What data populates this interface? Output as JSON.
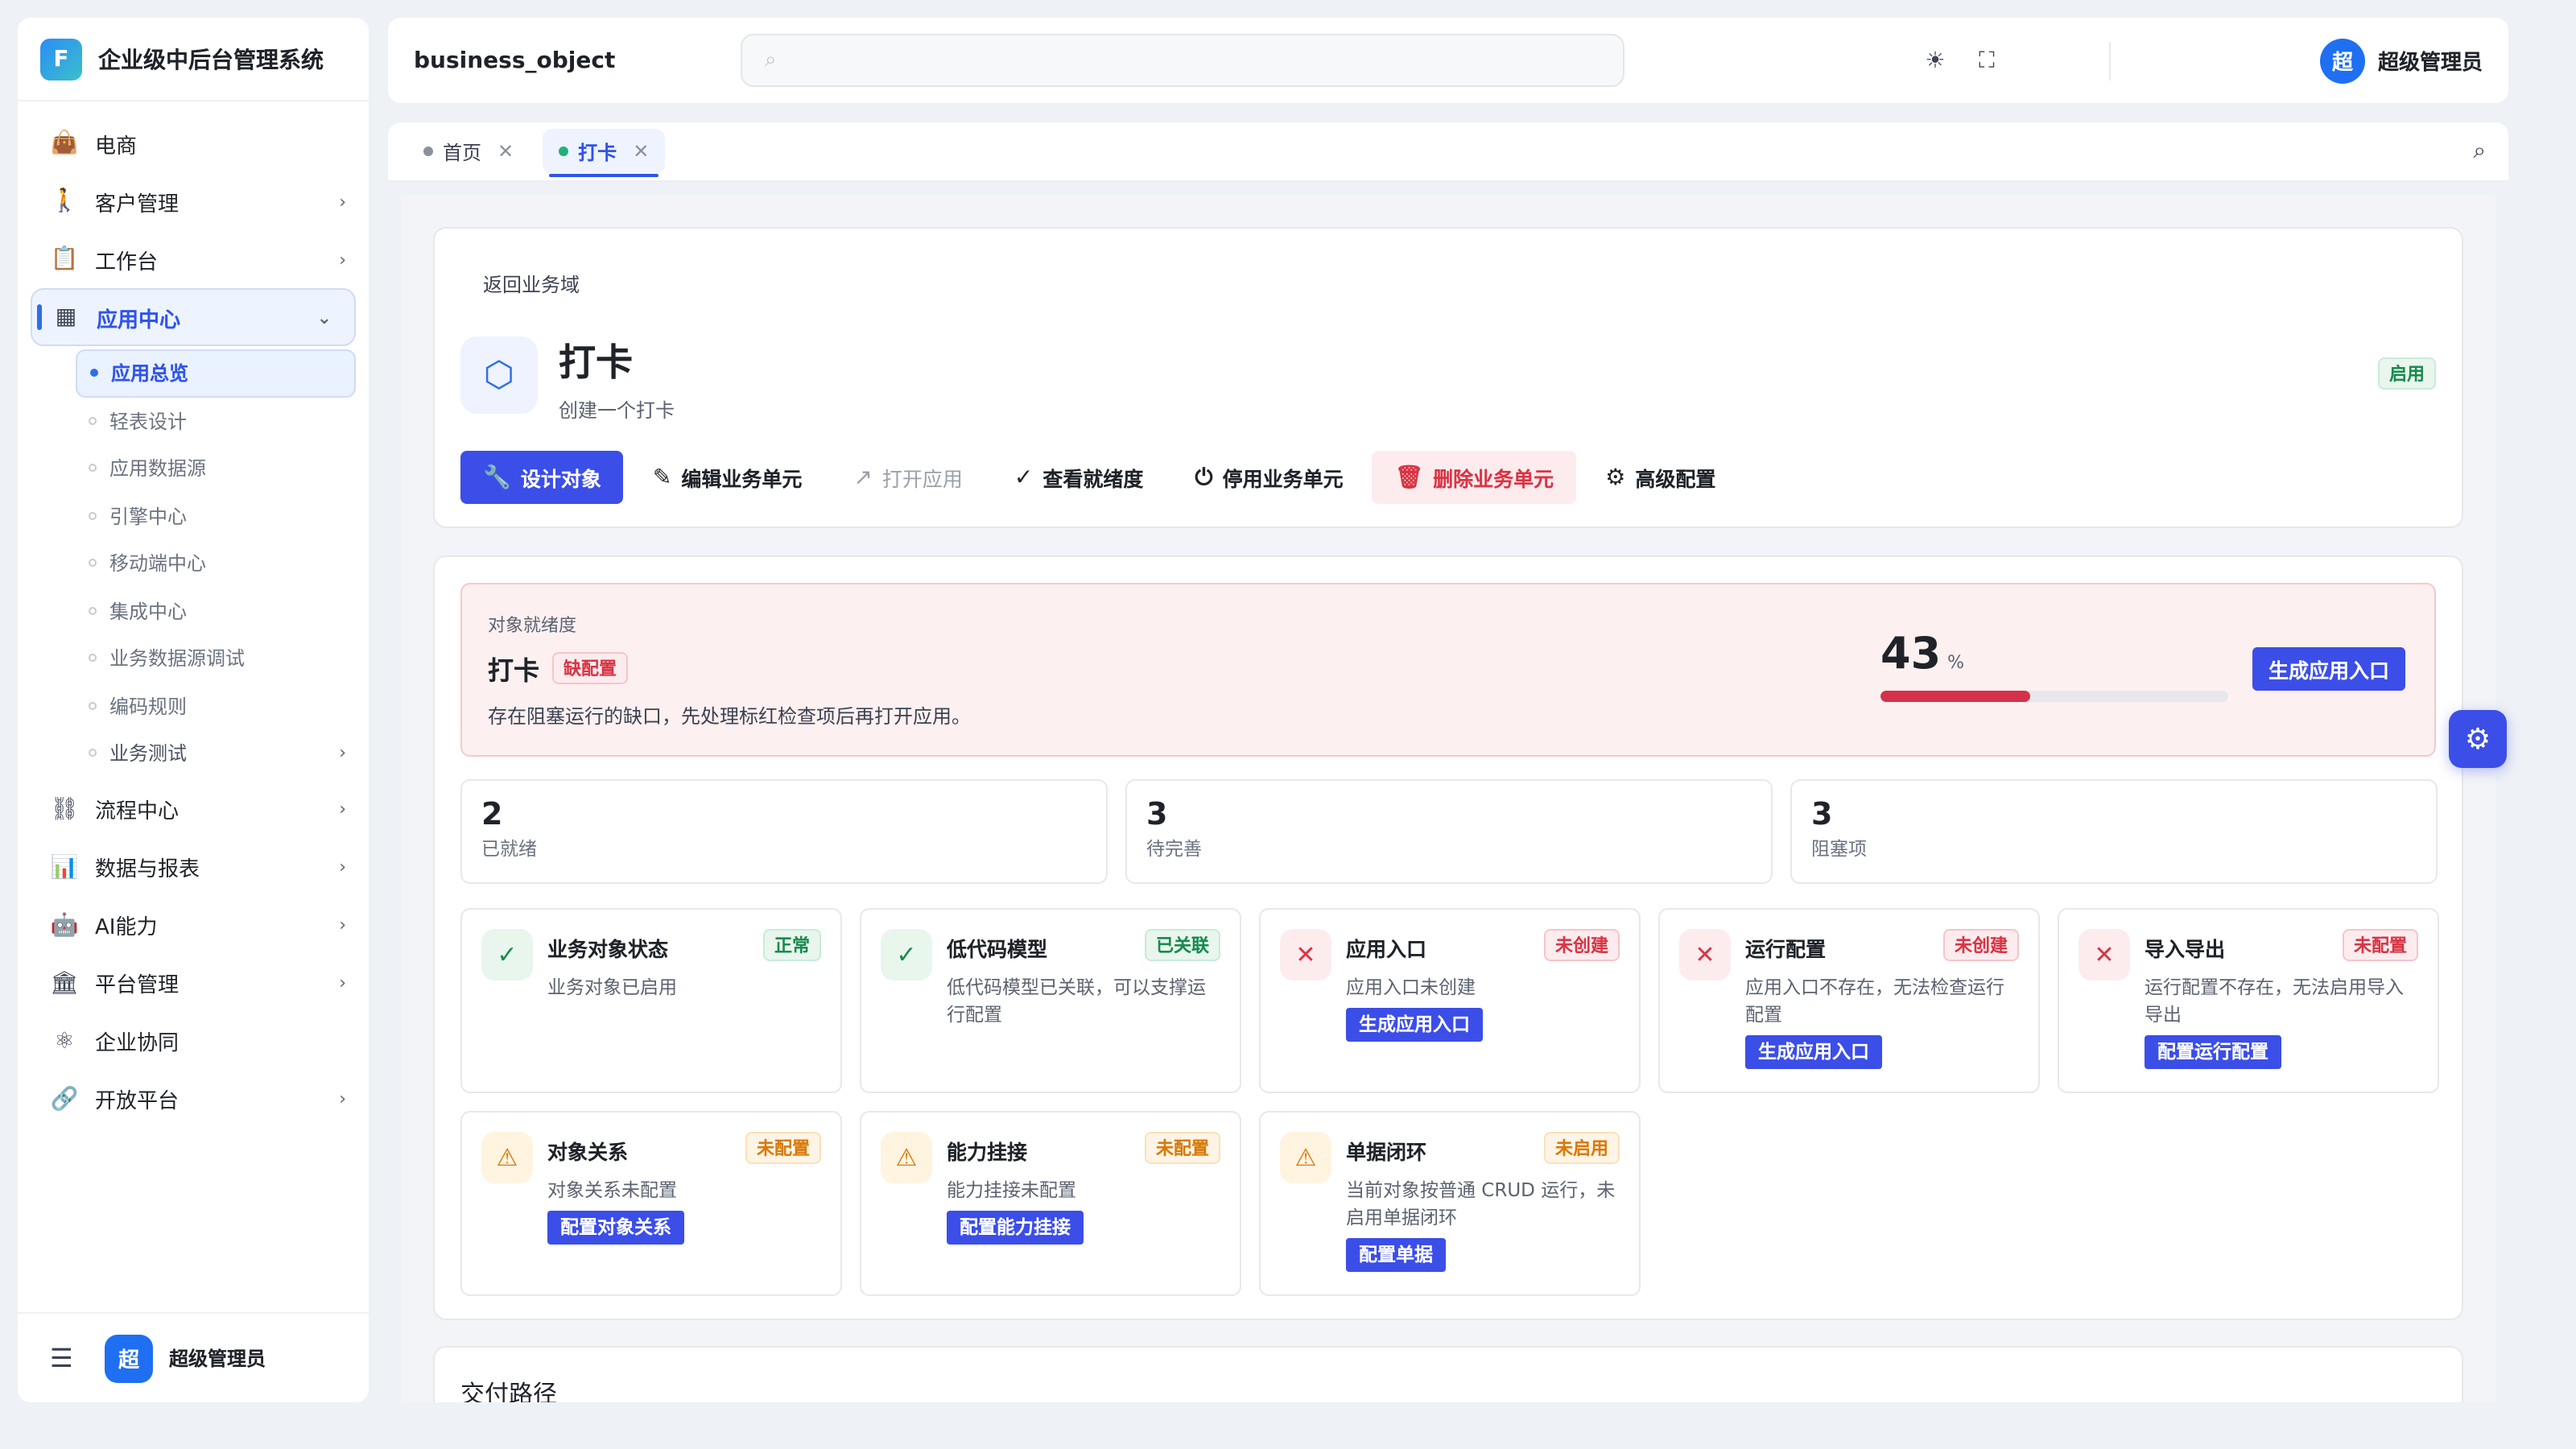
{
  "brand": {
    "title": "企业级中后台管理系统",
    "logo_letter": "F"
  },
  "sidebar": {
    "items": [
      {
        "label": "电商",
        "icon": "bag-icon",
        "glyph": "👜",
        "has_arrow": false
      },
      {
        "label": "客户管理",
        "icon": "person-icon",
        "glyph": "🚶",
        "has_arrow": true
      },
      {
        "label": "工作台",
        "icon": "clipboard-icon",
        "glyph": "📋",
        "has_arrow": true
      },
      {
        "label": "应用中心",
        "icon": "app-center-icon",
        "glyph": "▦",
        "has_arrow": true,
        "active": true
      }
    ],
    "subitems": [
      {
        "label": "应用总览",
        "active": true
      },
      {
        "label": "轻表设计"
      },
      {
        "label": "应用数据源"
      },
      {
        "label": "引擎中心"
      },
      {
        "label": "移动端中心"
      },
      {
        "label": "集成中心"
      },
      {
        "label": "业务数据源调试"
      },
      {
        "label": "编码规则"
      },
      {
        "label": "业务测试",
        "has_children": true
      }
    ],
    "items_after": [
      {
        "label": "流程中心",
        "icon": "flow-icon",
        "glyph": "⛓",
        "has_arrow": true
      },
      {
        "label": "数据与报表",
        "icon": "report-icon",
        "glyph": "📊",
        "has_arrow": true
      },
      {
        "label": "AI能力",
        "icon": "ai-icon",
        "glyph": "🤖",
        "has_arrow": true
      },
      {
        "label": "平台管理",
        "icon": "platform-icon",
        "glyph": "🏛",
        "has_arrow": true
      },
      {
        "label": "企业协同",
        "icon": "collab-icon",
        "glyph": "⚛",
        "has_arrow": false
      },
      {
        "label": "开放平台",
        "icon": "open-platform-icon",
        "glyph": "🔗",
        "has_arrow": true
      }
    ],
    "footer": {
      "avatar_char": "超",
      "username": "超级管理员"
    }
  },
  "header": {
    "app_name": "business_object",
    "search_placeholder": "",
    "avatar_char": "超",
    "username": "超级管理员"
  },
  "tabs": [
    {
      "label": "首页",
      "active": false
    },
    {
      "label": "打卡",
      "active": true
    }
  ],
  "object": {
    "back_label": "返回业务域",
    "title": "打卡",
    "subtitle": "创建一个打卡",
    "status": "启用",
    "actions": [
      {
        "label": "设计对象",
        "icon": "wrench-icon",
        "glyph": "🔧",
        "kind": "primary"
      },
      {
        "label": "编辑业务单元",
        "icon": "edit-icon",
        "glyph": "✎",
        "kind": "normal"
      },
      {
        "label": "打开应用",
        "icon": "external-link-icon",
        "glyph": "↗",
        "kind": "disabled"
      },
      {
        "label": "查看就绪度",
        "icon": "check-circle-icon",
        "glyph": "✓",
        "kind": "normal"
      },
      {
        "label": "停用业务单元",
        "icon": "power-icon",
        "glyph": "⏻",
        "kind": "normal"
      },
      {
        "label": "删除业务单元",
        "icon": "trash-icon",
        "glyph": "🗑",
        "kind": "danger"
      },
      {
        "label": "高级配置",
        "icon": "gear-icon",
        "glyph": "⚙",
        "kind": "normal"
      }
    ]
  },
  "readiness": {
    "caption": "对象就绪度",
    "title": "打卡",
    "badge": "缺配置",
    "description": "存在阻塞运行的缺口，先处理标红检查项后再打开应用。",
    "percent": 43,
    "percent_unit": "%",
    "button": "生成应用入口",
    "colors": {
      "bar": "#d4314a",
      "accent": "#3b4ee8"
    }
  },
  "stats": [
    {
      "value": "2",
      "label": "已就绪"
    },
    {
      "value": "3",
      "label": "待完善"
    },
    {
      "value": "3",
      "label": "阻塞项"
    }
  ],
  "checks": [
    {
      "title": "业务对象状态",
      "badge": "正常",
      "badge_color": "green",
      "state": "ok",
      "desc": "业务对象已启用",
      "button": ""
    },
    {
      "title": "低代码模型",
      "badge": "已关联",
      "badge_color": "green",
      "state": "ok",
      "desc": "低代码模型已关联，可以支撑运行配置",
      "button": ""
    },
    {
      "title": "应用入口",
      "badge": "未创建",
      "badge_color": "red",
      "state": "err",
      "desc": "应用入口未创建",
      "button": "生成应用入口"
    },
    {
      "title": "运行配置",
      "badge": "未创建",
      "badge_color": "red",
      "state": "err",
      "desc": "应用入口不存在，无法检查运行配置",
      "button": "生成应用入口"
    },
    {
      "title": "导入导出",
      "badge": "未配置",
      "badge_color": "red",
      "state": "err",
      "desc": "运行配置不存在，无法启用导入导出",
      "button": "配置运行配置"
    },
    {
      "title": "对象关系",
      "badge": "未配置",
      "badge_color": "orange",
      "state": "warn",
      "desc": "对象关系未配置",
      "button": "配置对象关系"
    },
    {
      "title": "能力挂接",
      "badge": "未配置",
      "badge_color": "orange",
      "state": "warn",
      "desc": "能力挂接未配置",
      "button": "配置能力挂接"
    },
    {
      "title": "单据闭环",
      "badge": "未启用",
      "badge_color": "orange",
      "state": "warn",
      "desc": "当前对象按普通 CRUD 运行，未启用单据闭环",
      "button": "配置单据"
    }
  ],
  "delivery": {
    "title": "交付路径"
  }
}
